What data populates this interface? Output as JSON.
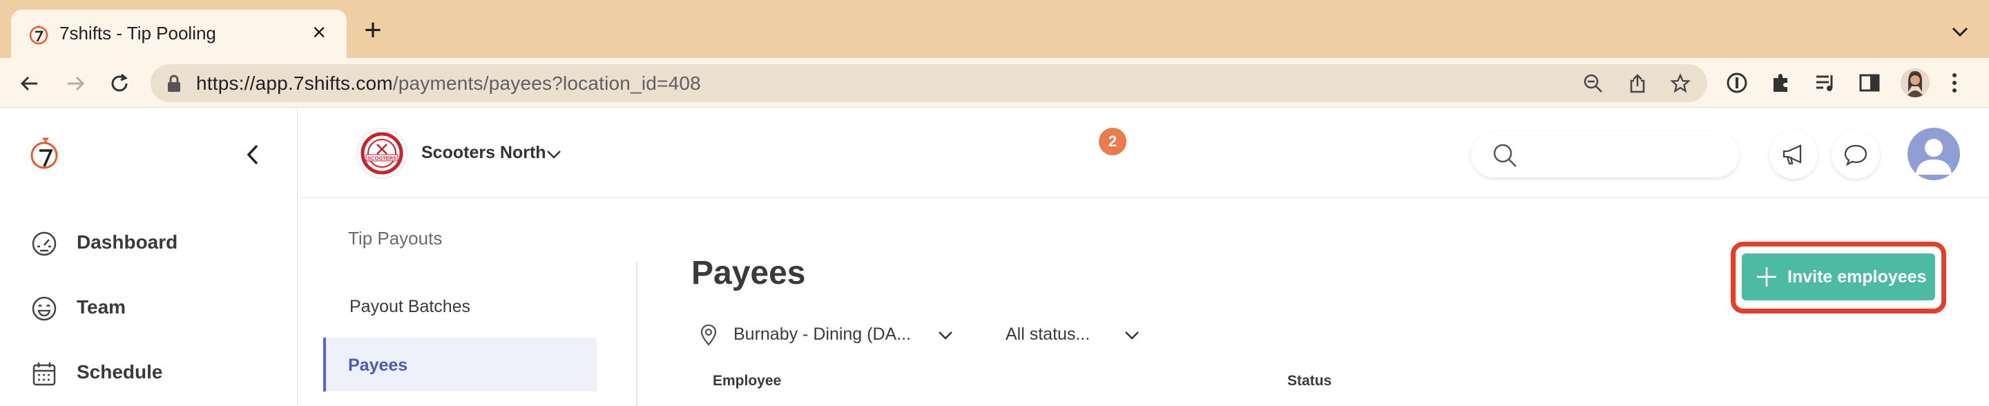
{
  "browser": {
    "tab_title": "7shifts - Tip Pooling",
    "url_host": "https://app.7shifts.com",
    "url_path": "/payments/payees?location_id=408"
  },
  "sidebar": {
    "items": [
      {
        "label": "Dashboard",
        "icon": "dashboard-gauge-icon"
      },
      {
        "label": "Team",
        "icon": "smiley-icon"
      },
      {
        "label": "Schedule",
        "icon": "calendar-icon"
      }
    ]
  },
  "header": {
    "location_name": "Scooters North",
    "notification_count": "2",
    "logo_text": "SCOOTERS"
  },
  "subnav": {
    "title": "Tip Payouts",
    "items": [
      {
        "label": "Payout Batches",
        "active": false
      },
      {
        "label": "Payees",
        "active": true
      }
    ]
  },
  "main": {
    "title": "Payees",
    "invite_label": "Invite employees",
    "location_filter": "Burnaby - Dining (DA...",
    "status_filter": "All status...",
    "columns": [
      "Employee",
      "Status"
    ]
  },
  "colors": {
    "accent": "#4dbba4",
    "highlight": "#e43d2a",
    "active_nav": "#5567c8",
    "badge": "#ea7b4d"
  }
}
